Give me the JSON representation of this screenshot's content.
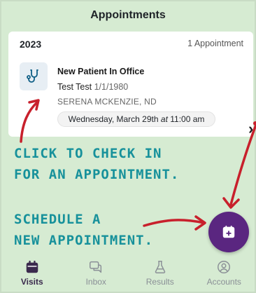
{
  "header": {
    "title": "Appointments"
  },
  "appointments": {
    "year": "2023",
    "count_label": "1 Appointment",
    "item": {
      "title": "New Patient In Office",
      "patient_name": "Test Test",
      "patient_dob": "1/1/1980",
      "provider": "SERENA MCKENZIE, ND",
      "date_prefix": "Wednesday, March 29th",
      "date_at": "at",
      "date_time": "11:00 am",
      "icon": "stethoscope-icon",
      "chevron": "chevron-right-icon"
    }
  },
  "annotations": {
    "check_in_line1": "CLICK TO CHECK IN",
    "check_in_line2": "FOR AN APPOINTMENT.",
    "schedule_line1": "SCHEDULE A",
    "schedule_line2": "NEW APPOINTMENT."
  },
  "fab": {
    "icon": "calendar-plus-icon"
  },
  "tabs": [
    {
      "label": "Visits",
      "icon": "calendar-icon",
      "active": true
    },
    {
      "label": "Inbox",
      "icon": "chat-icon",
      "active": false
    },
    {
      "label": "Results",
      "icon": "flask-icon",
      "active": false
    },
    {
      "label": "Accounts",
      "icon": "user-circle-icon",
      "active": false
    }
  ],
  "colors": {
    "background": "#d6ebd2",
    "accent_purple": "#5a2680",
    "annotation_teal": "#17919b",
    "arrow_red": "#c8202c"
  }
}
